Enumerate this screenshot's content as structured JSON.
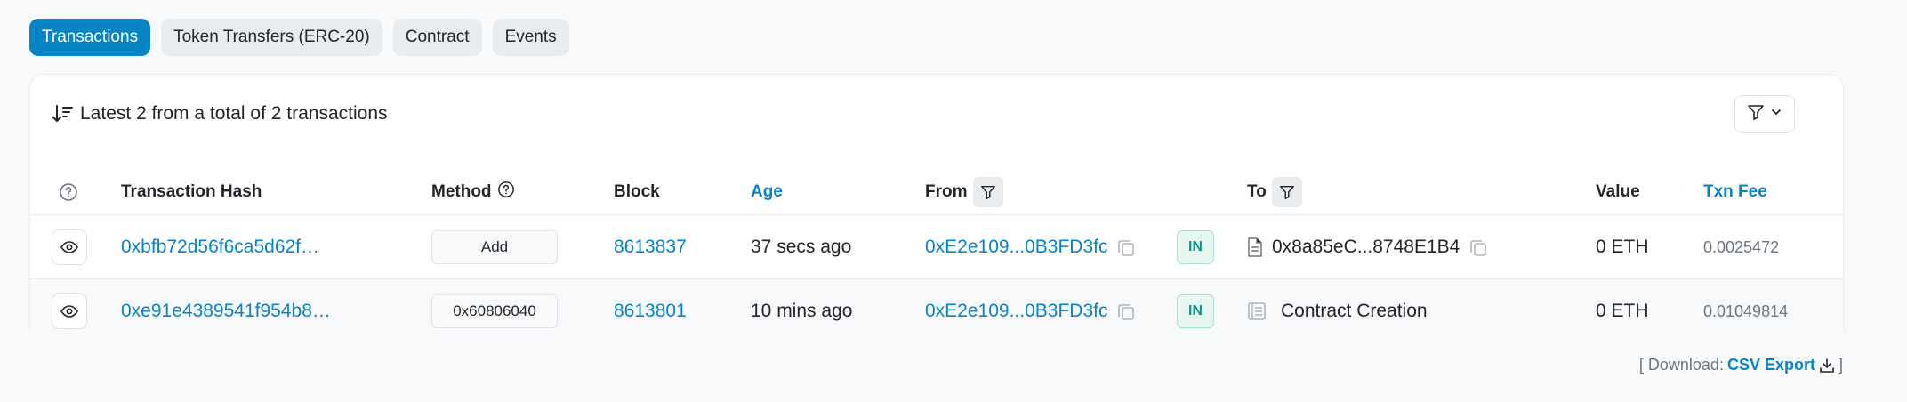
{
  "tabs": [
    {
      "label": "Transactions",
      "active": true
    },
    {
      "label": "Token Transfers (ERC-20)",
      "active": false
    },
    {
      "label": "Contract",
      "active": false
    },
    {
      "label": "Events",
      "active": false
    }
  ],
  "summary": {
    "text": "Latest 2 from a total of 2 transactions"
  },
  "columns": {
    "help_icon": "question-circle-icon",
    "hash": "Transaction Hash",
    "method": "Method",
    "block": "Block",
    "age": "Age",
    "from": "From",
    "to": "To",
    "value": "Value",
    "fee": "Txn Fee"
  },
  "rows": [
    {
      "hash": "0xbfb72d56f6ca5d62f…",
      "method": "Add",
      "block": "8613837",
      "age": "37 secs ago",
      "from": "0xE2e109...0B3FD3fc",
      "direction": "IN",
      "to": "0x8a85eC...8748E1B4",
      "to_icon": "document-icon",
      "value": "0 ETH",
      "fee": "0.0025472"
    },
    {
      "hash": "0xe91e4389541f954b8…",
      "method": "0x60806040",
      "block": "8613801",
      "age": "10 mins ago",
      "from": "0xE2e109...0B3FD3fc",
      "direction": "IN",
      "to": "Contract Creation",
      "to_icon": "contract-creation-icon",
      "value": "0 ETH",
      "fee": "0.01049814"
    }
  ],
  "download": {
    "open": "[ Download:",
    "link": "CSV Export",
    "close": "]"
  },
  "colors": {
    "accent": "#0784c3",
    "in_badge": "#00a186",
    "background": "#f8f9fb"
  }
}
